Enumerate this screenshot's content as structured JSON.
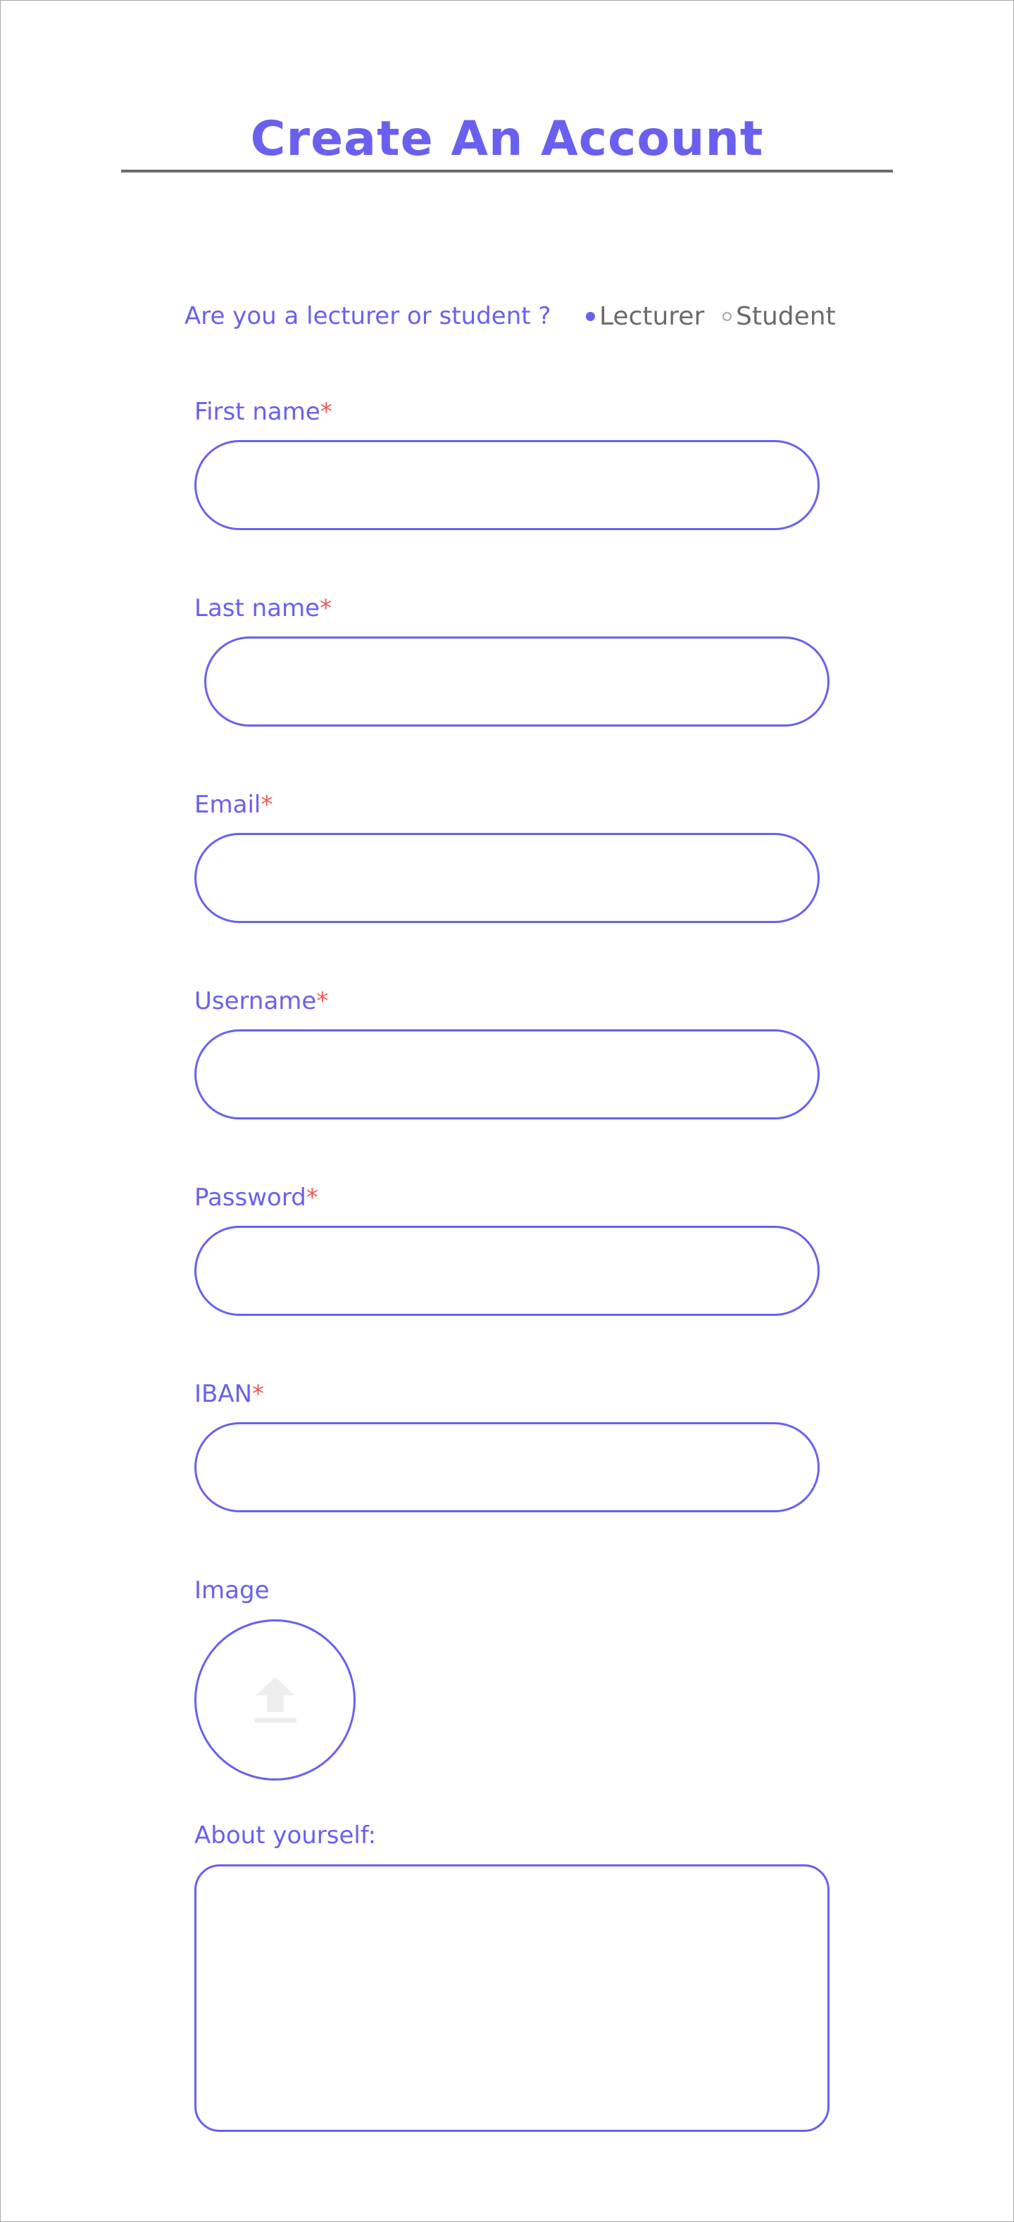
{
  "header": {
    "title": "Create An Account"
  },
  "role": {
    "question": "Are you a lecturer or student ?",
    "options": [
      {
        "label": "Lecturer",
        "selected": true
      },
      {
        "label": "Student",
        "selected": false
      }
    ]
  },
  "fields": {
    "first_name": {
      "label": "First name",
      "required_mark": "*",
      "value": ""
    },
    "last_name": {
      "label": "Last name",
      "required_mark": "*",
      "value": ""
    },
    "email": {
      "label": "Email",
      "required_mark": "*",
      "value": ""
    },
    "username": {
      "label": "Username",
      "required_mark": "*",
      "value": ""
    },
    "password": {
      "label": "Password",
      "required_mark": "*",
      "value": ""
    },
    "iban": {
      "label": "IBAN",
      "required_mark": "*",
      "value": ""
    }
  },
  "image": {
    "label": "Image",
    "icon": "upload-icon"
  },
  "about": {
    "label": "About yourself:",
    "value": ""
  },
  "colors": {
    "accent": "#6a60f0",
    "required": "#ee5a5a",
    "muted": "#6b6b6b"
  }
}
